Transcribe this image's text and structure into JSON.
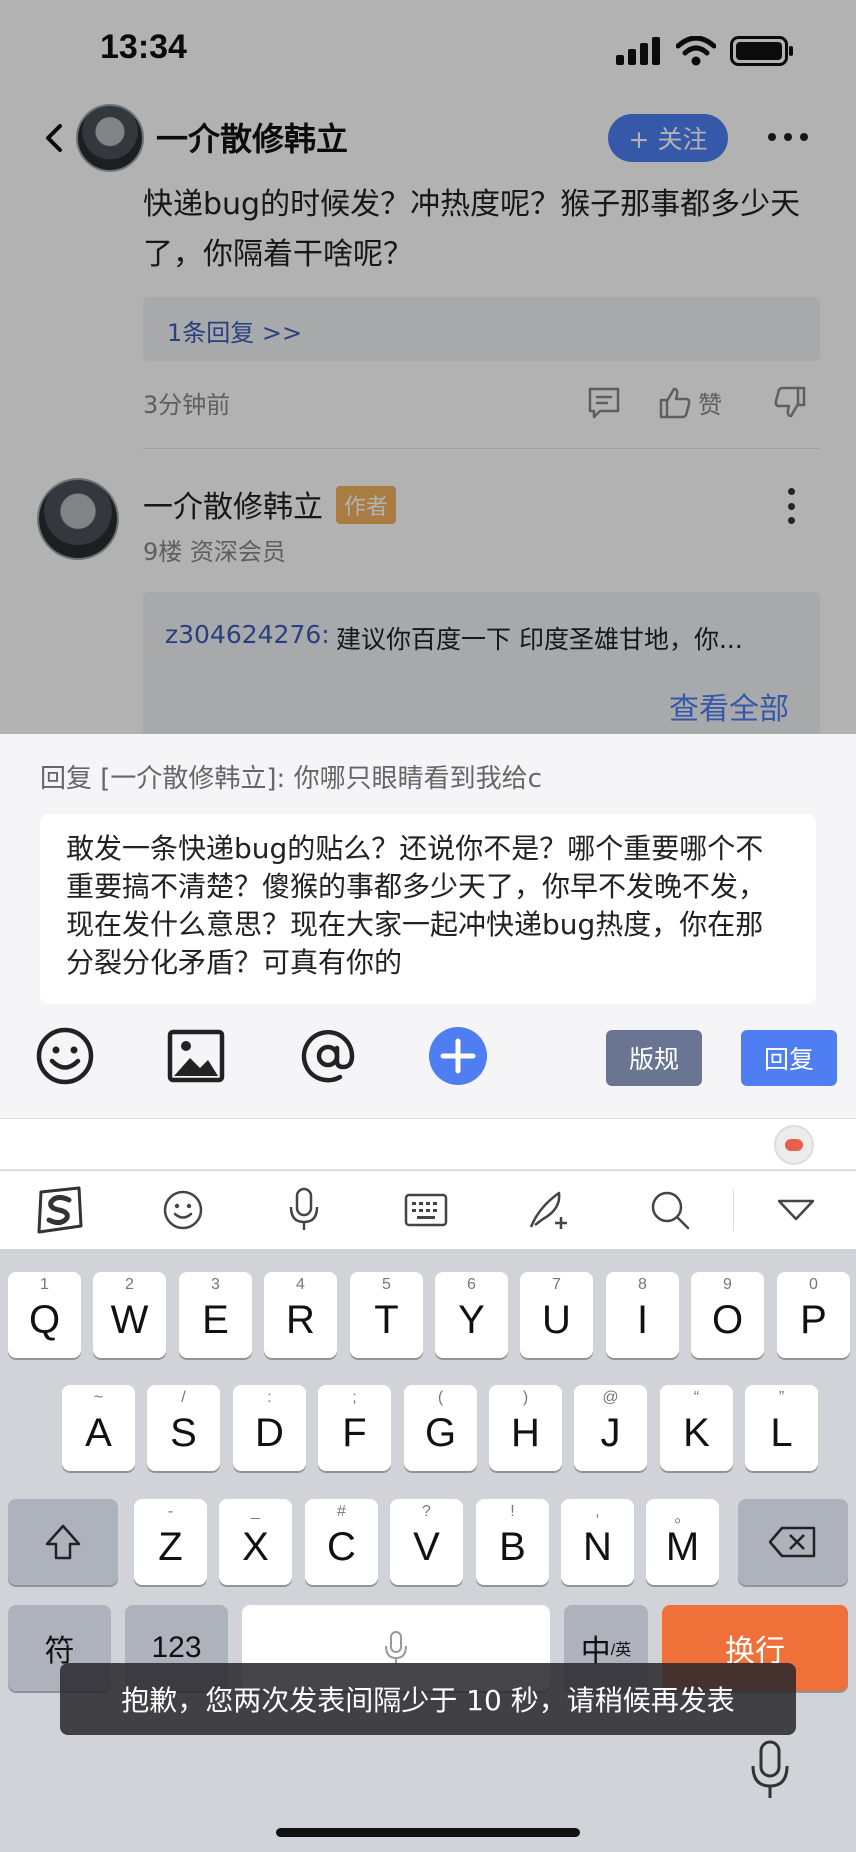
{
  "status": {
    "time": "13:34"
  },
  "nav": {
    "name": "一介散修韩立",
    "follow_label": "+ 关注"
  },
  "comment1": {
    "text": "快递bug的时候发？冲热度呢？猴子那事都多少天了，你隔着干啥呢？",
    "reply_link": "1条回复 >>",
    "time": "3分钟前",
    "like_label": "赞"
  },
  "comment2": {
    "name": "一介散修韩立",
    "author_badge": "作者",
    "meta": "9楼 资深会员",
    "sub_reply_user": "z304624276:",
    "sub_reply_text": "建议你百度一下 印度圣雄甘地，你...",
    "view_all": "查看全部"
  },
  "reply_panel": {
    "header": "回复 [一介散修韩立]: 你哪只眼睛看到我给c",
    "input_text": "敢发一条快递bug的贴么？还说你不是？哪个重要哪个不重要搞不清楚？傻猴的事都多少天了，你早不发晚不发，现在发什么意思？现在大家一起冲快递bug热度，你在那分裂分化矛盾？可真有你的",
    "rules_label": "版规",
    "send_label": "回复"
  },
  "keyboard": {
    "row1": [
      {
        "k": "Q",
        "h": "1"
      },
      {
        "k": "W",
        "h": "2"
      },
      {
        "k": "E",
        "h": "3"
      },
      {
        "k": "R",
        "h": "4"
      },
      {
        "k": "T",
        "h": "5"
      },
      {
        "k": "Y",
        "h": "6"
      },
      {
        "k": "U",
        "h": "7"
      },
      {
        "k": "I",
        "h": "8"
      },
      {
        "k": "O",
        "h": "9"
      },
      {
        "k": "P",
        "h": "0"
      }
    ],
    "row2": [
      {
        "k": "A",
        "h": "~"
      },
      {
        "k": "S",
        "h": "/"
      },
      {
        "k": "D",
        "h": ":"
      },
      {
        "k": "F",
        "h": ";"
      },
      {
        "k": "G",
        "h": "("
      },
      {
        "k": "H",
        "h": ")"
      },
      {
        "k": "J",
        "h": "@"
      },
      {
        "k": "K",
        "h": "“"
      },
      {
        "k": "L",
        "h": "”"
      }
    ],
    "row3": [
      {
        "k": "Z",
        "h": "-"
      },
      {
        "k": "X",
        "h": "_"
      },
      {
        "k": "C",
        "h": "#"
      },
      {
        "k": "V",
        "h": "?"
      },
      {
        "k": "B",
        "h": "!"
      },
      {
        "k": "N",
        "h": ","
      },
      {
        "k": "M",
        "h": "。"
      }
    ],
    "symbol_key": "符",
    "num_key": "123",
    "lang_key": "中",
    "lang_sub": "/英",
    "return_key": "换行"
  },
  "toast": "抱歉，您两次发表间隔少于 10 秒，请稍候再发表"
}
